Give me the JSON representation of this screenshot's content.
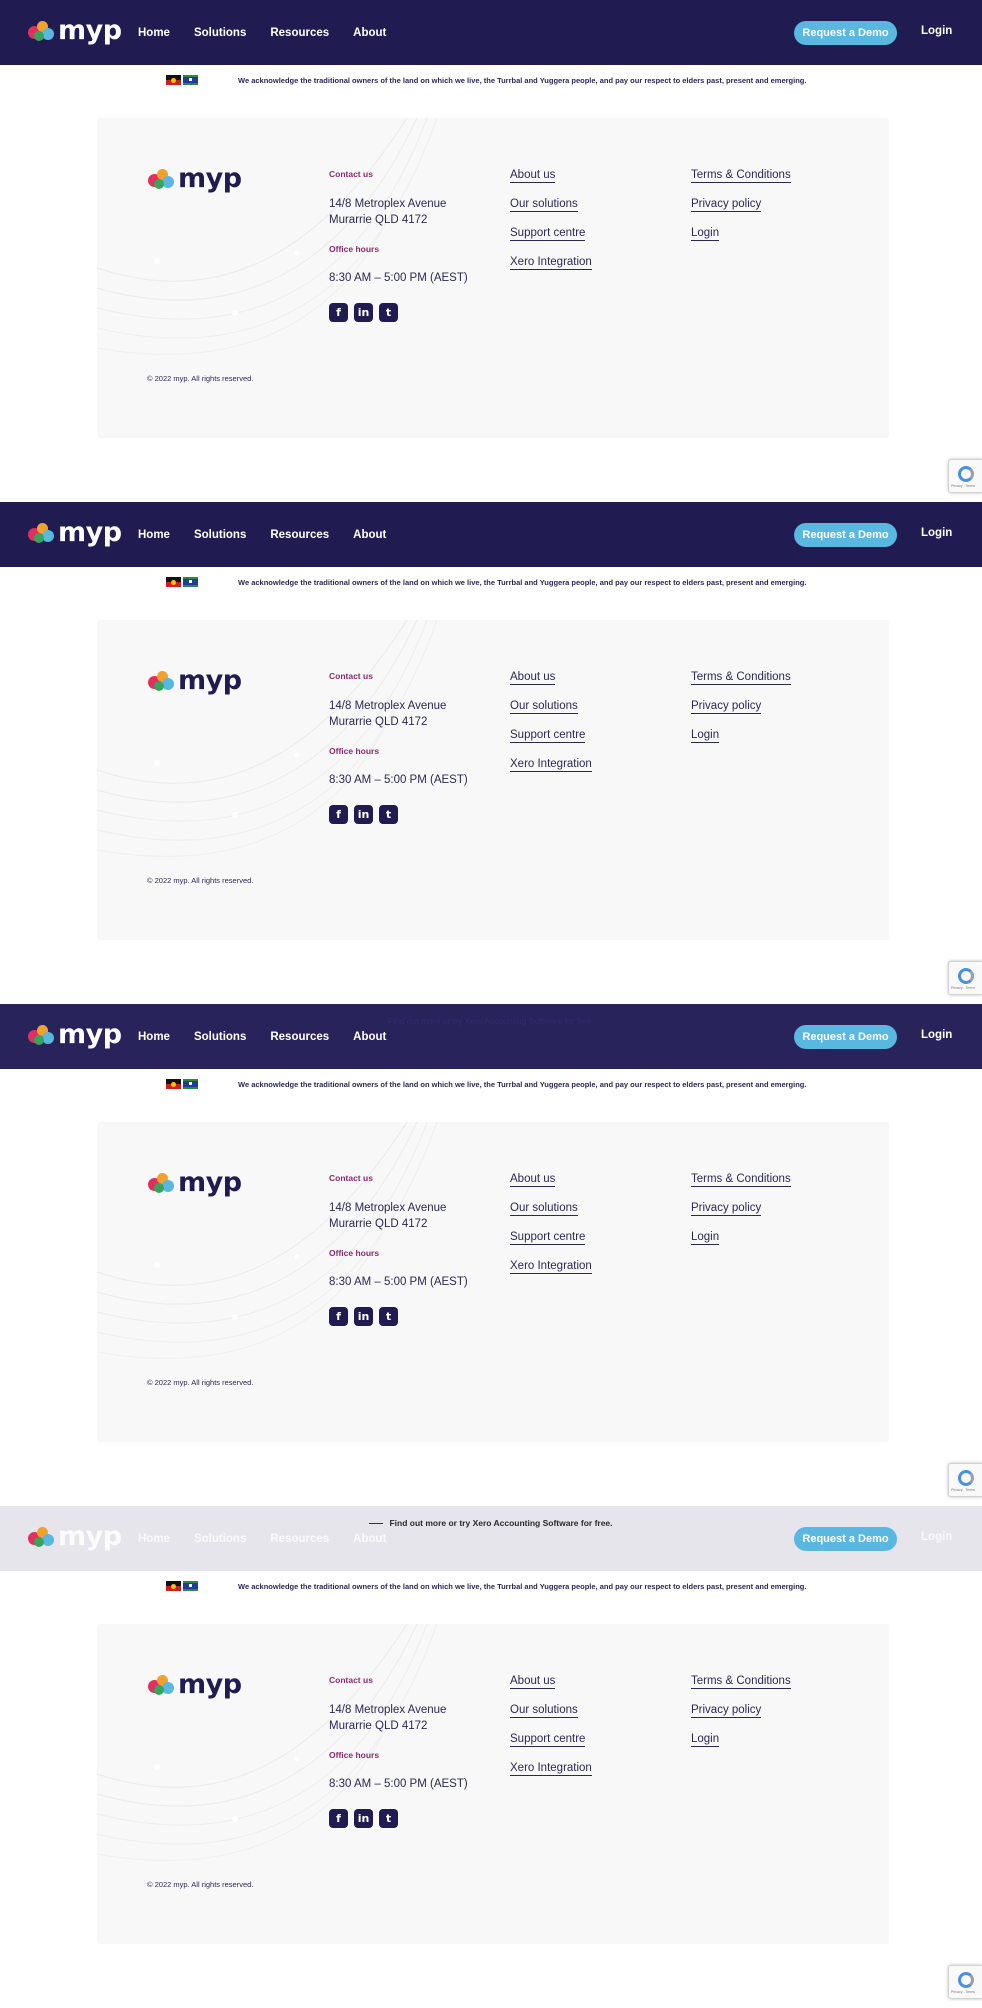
{
  "nav": {
    "logo_text": "myp",
    "menu": [
      "Home",
      "Solutions",
      "Resources",
      "About"
    ],
    "demo_button": "Request a Demo",
    "login": "Login",
    "brand_color": "#201c52",
    "accent_color": "#5ab8e0"
  },
  "banner": {
    "text": "Find out more or try Xero Accounting Software for free."
  },
  "acknowledgement": {
    "text": "We acknowledge the traditional owners of the land on which we live, the Turrbal and Yuggera people, and pay our respect to elders past, present and emerging.",
    "flags": [
      "aboriginal-flag-icon",
      "torres-strait-islander-flag-icon"
    ]
  },
  "footer": {
    "logo_text": "myp",
    "contact_label": "Contact us",
    "address_line1": "14/8 Metroplex Avenue",
    "address_line2": "Murarrie QLD 4172",
    "hours_label": "Office hours",
    "hours": "8:30 AM – 5:00 PM (AEST)",
    "socials": [
      {
        "icon": "facebook-icon",
        "glyph": "f"
      },
      {
        "icon": "linkedin-icon",
        "glyph": "in"
      },
      {
        "icon": "twitter-icon",
        "glyph": "t"
      }
    ],
    "links_col1": [
      "About us",
      "Our solutions",
      "Support centre",
      "Xero Integration"
    ],
    "links_col2": [
      "Terms & Conditions",
      "Privacy policy",
      "Login"
    ],
    "copyright": "© 2022 myp.  All rights reserved."
  },
  "recaptcha": {
    "text": "Privacy - Terms"
  }
}
